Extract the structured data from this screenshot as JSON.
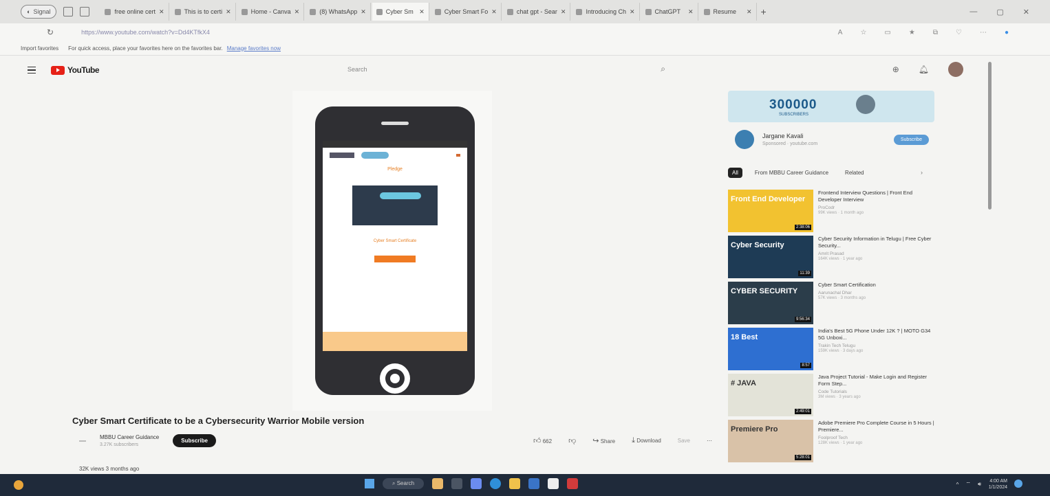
{
  "browser": {
    "profile_label": "Signal",
    "tabs": [
      {
        "label": "free online cert",
        "active": false
      },
      {
        "label": "This is to certi",
        "active": false
      },
      {
        "label": "Home - Canva",
        "active": false
      },
      {
        "label": "(8) WhatsApp",
        "active": false
      },
      {
        "label": "Cyber Sm",
        "active": true
      },
      {
        "label": "Cyber Smart Fo",
        "active": false
      },
      {
        "label": "chat gpt - Sear",
        "active": false
      },
      {
        "label": "Introducing Ch",
        "active": false
      },
      {
        "label": "ChatGPT",
        "active": false
      },
      {
        "label": "Resume",
        "active": false
      }
    ],
    "url": "https://www.youtube.com/watch?v=Dd4KTfkX4",
    "favorites_bar": {
      "import_label": "Import favorites",
      "tip": "For quick access, place your favorites here on the favorites bar.",
      "manage_link": "Manage favorites now"
    }
  },
  "youtube": {
    "logo_text": "YouTube",
    "search_placeholder": "Search"
  },
  "phone": {
    "badge_text": "Pledge",
    "caption": "Cyber Smart Certificate"
  },
  "video": {
    "title": "Cyber Smart Certificate to be a Cybersecurity Warrior Mobile version",
    "channel_name": "MBBU Career Guidance",
    "channel_subs": "3.27K subscribers",
    "subscribe_label": "Subscribe",
    "likes": "662",
    "share_label": "Share",
    "download_label": "Download",
    "save_label": "Save",
    "views": "32K views  3 months ago"
  },
  "ad": {
    "banner_number": "300000",
    "banner_sub": "SUBSCRIBERS",
    "channel": "Jargane Kavali",
    "sponsored": "Sponsored · youtube.com",
    "subscribe_label": "Subscribe"
  },
  "chips": [
    "All",
    "From MBBU Career Guidance",
    "Related"
  ],
  "recommendations": [
    {
      "thumb_label": "Front End Developer",
      "thumb_color": "#f2c230",
      "duration": "2:38:06",
      "title": "Frontend Interview Questions | Front End Developer Interview",
      "channel": "ProCodr",
      "meta": "99K views · 1 month ago"
    },
    {
      "thumb_label": "Cyber Security",
      "thumb_color": "#1e3b55",
      "duration": "11:39",
      "title": "Cyber Security Information in Telugu | Free Cyber Security...",
      "channel": "Amrit Prasad",
      "meta": "164K views · 1 year ago"
    },
    {
      "thumb_label": "CYBER SECURITY",
      "thumb_color": "#2b3d4a",
      "duration": "9:56:34",
      "title": "Cyber Smart Certification",
      "channel": "Aarunachal Dhar",
      "meta": "57K views · 3 months ago"
    },
    {
      "thumb_label": "18 Best",
      "thumb_color": "#2e6fd1",
      "duration": "8:57",
      "title": "India's Best 5G Phone Under 12K ? | MOTO G34 5G Unboxi...",
      "channel": "Trakin Tech Telugu",
      "meta": "159K views · 3 days ago"
    },
    {
      "thumb_label": "# JAVA",
      "thumb_color": "#e3e3d8",
      "duration": "2:49:01",
      "title": "Java Project Tutorial - Make Login and Register Form Step...",
      "channel": "Code Tutorials",
      "meta": "3M views · 3 years ago"
    },
    {
      "thumb_label": "Premiere Pro",
      "thumb_color": "#d9c2a8",
      "duration": "5:28:01",
      "title": "Adobe Premiere Pro Complete Course in 5 Hours | Premiere...",
      "channel": "Foolproof Tech",
      "meta": "128K views · 1 year ago"
    }
  ],
  "taskbar": {
    "search_label": "Search",
    "clock_time": "4:00 AM",
    "clock_date": "1/1/2024"
  }
}
